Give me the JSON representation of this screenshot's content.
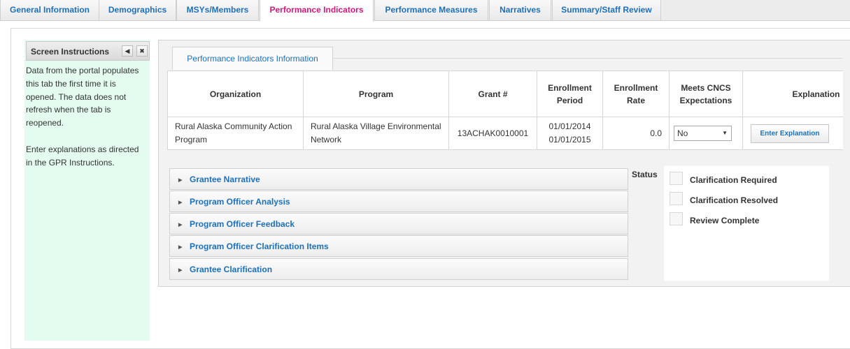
{
  "tabs": [
    {
      "label": "General Information"
    },
    {
      "label": "Demographics"
    },
    {
      "label": "MSYs/Members"
    },
    {
      "label": "Performance Indicators"
    },
    {
      "label": "Performance Measures"
    },
    {
      "label": "Narratives"
    },
    {
      "label": "Summary/Staff Review"
    }
  ],
  "active_tab": "Performance Indicators",
  "instructions": {
    "title": "Screen Instructions",
    "text": "Data from the portal populates this tab the first time it is opened. The data does not refresh when the tab is reopened.\n\nEnter explanations as directed in the GPR Instructions."
  },
  "section_tab": "Performance Indicators Information",
  "table": {
    "headers": {
      "organization": "Organization",
      "program": "Program",
      "grant": "Grant #",
      "enrollment_period": "Enrollment Period",
      "enrollment_rate": "Enrollment Rate",
      "meets": "Meets CNCS Expectations",
      "explanation": "Explanation"
    },
    "row": {
      "organization": "Rural Alaska Community Action Program",
      "program": "Rural Alaska Village Environmental Network",
      "grant": "13ACHAK0010001",
      "period_start": "01/01/2014",
      "period_end": "01/01/2015",
      "rate": "0.0",
      "meets": "No",
      "explain_button": "Enter Explanation"
    }
  },
  "accordion": [
    {
      "label": "Grantee Narrative"
    },
    {
      "label": "Program Officer Analysis"
    },
    {
      "label": "Program Officer Feedback"
    },
    {
      "label": "Program Officer Clarification Items"
    },
    {
      "label": "Grantee Clarification"
    }
  ],
  "status": {
    "label": "Status",
    "options": [
      {
        "label": "Clarification Required",
        "checked": false
      },
      {
        "label": "Clarification Resolved",
        "checked": false
      },
      {
        "label": "Review Complete",
        "checked": false
      }
    ]
  }
}
